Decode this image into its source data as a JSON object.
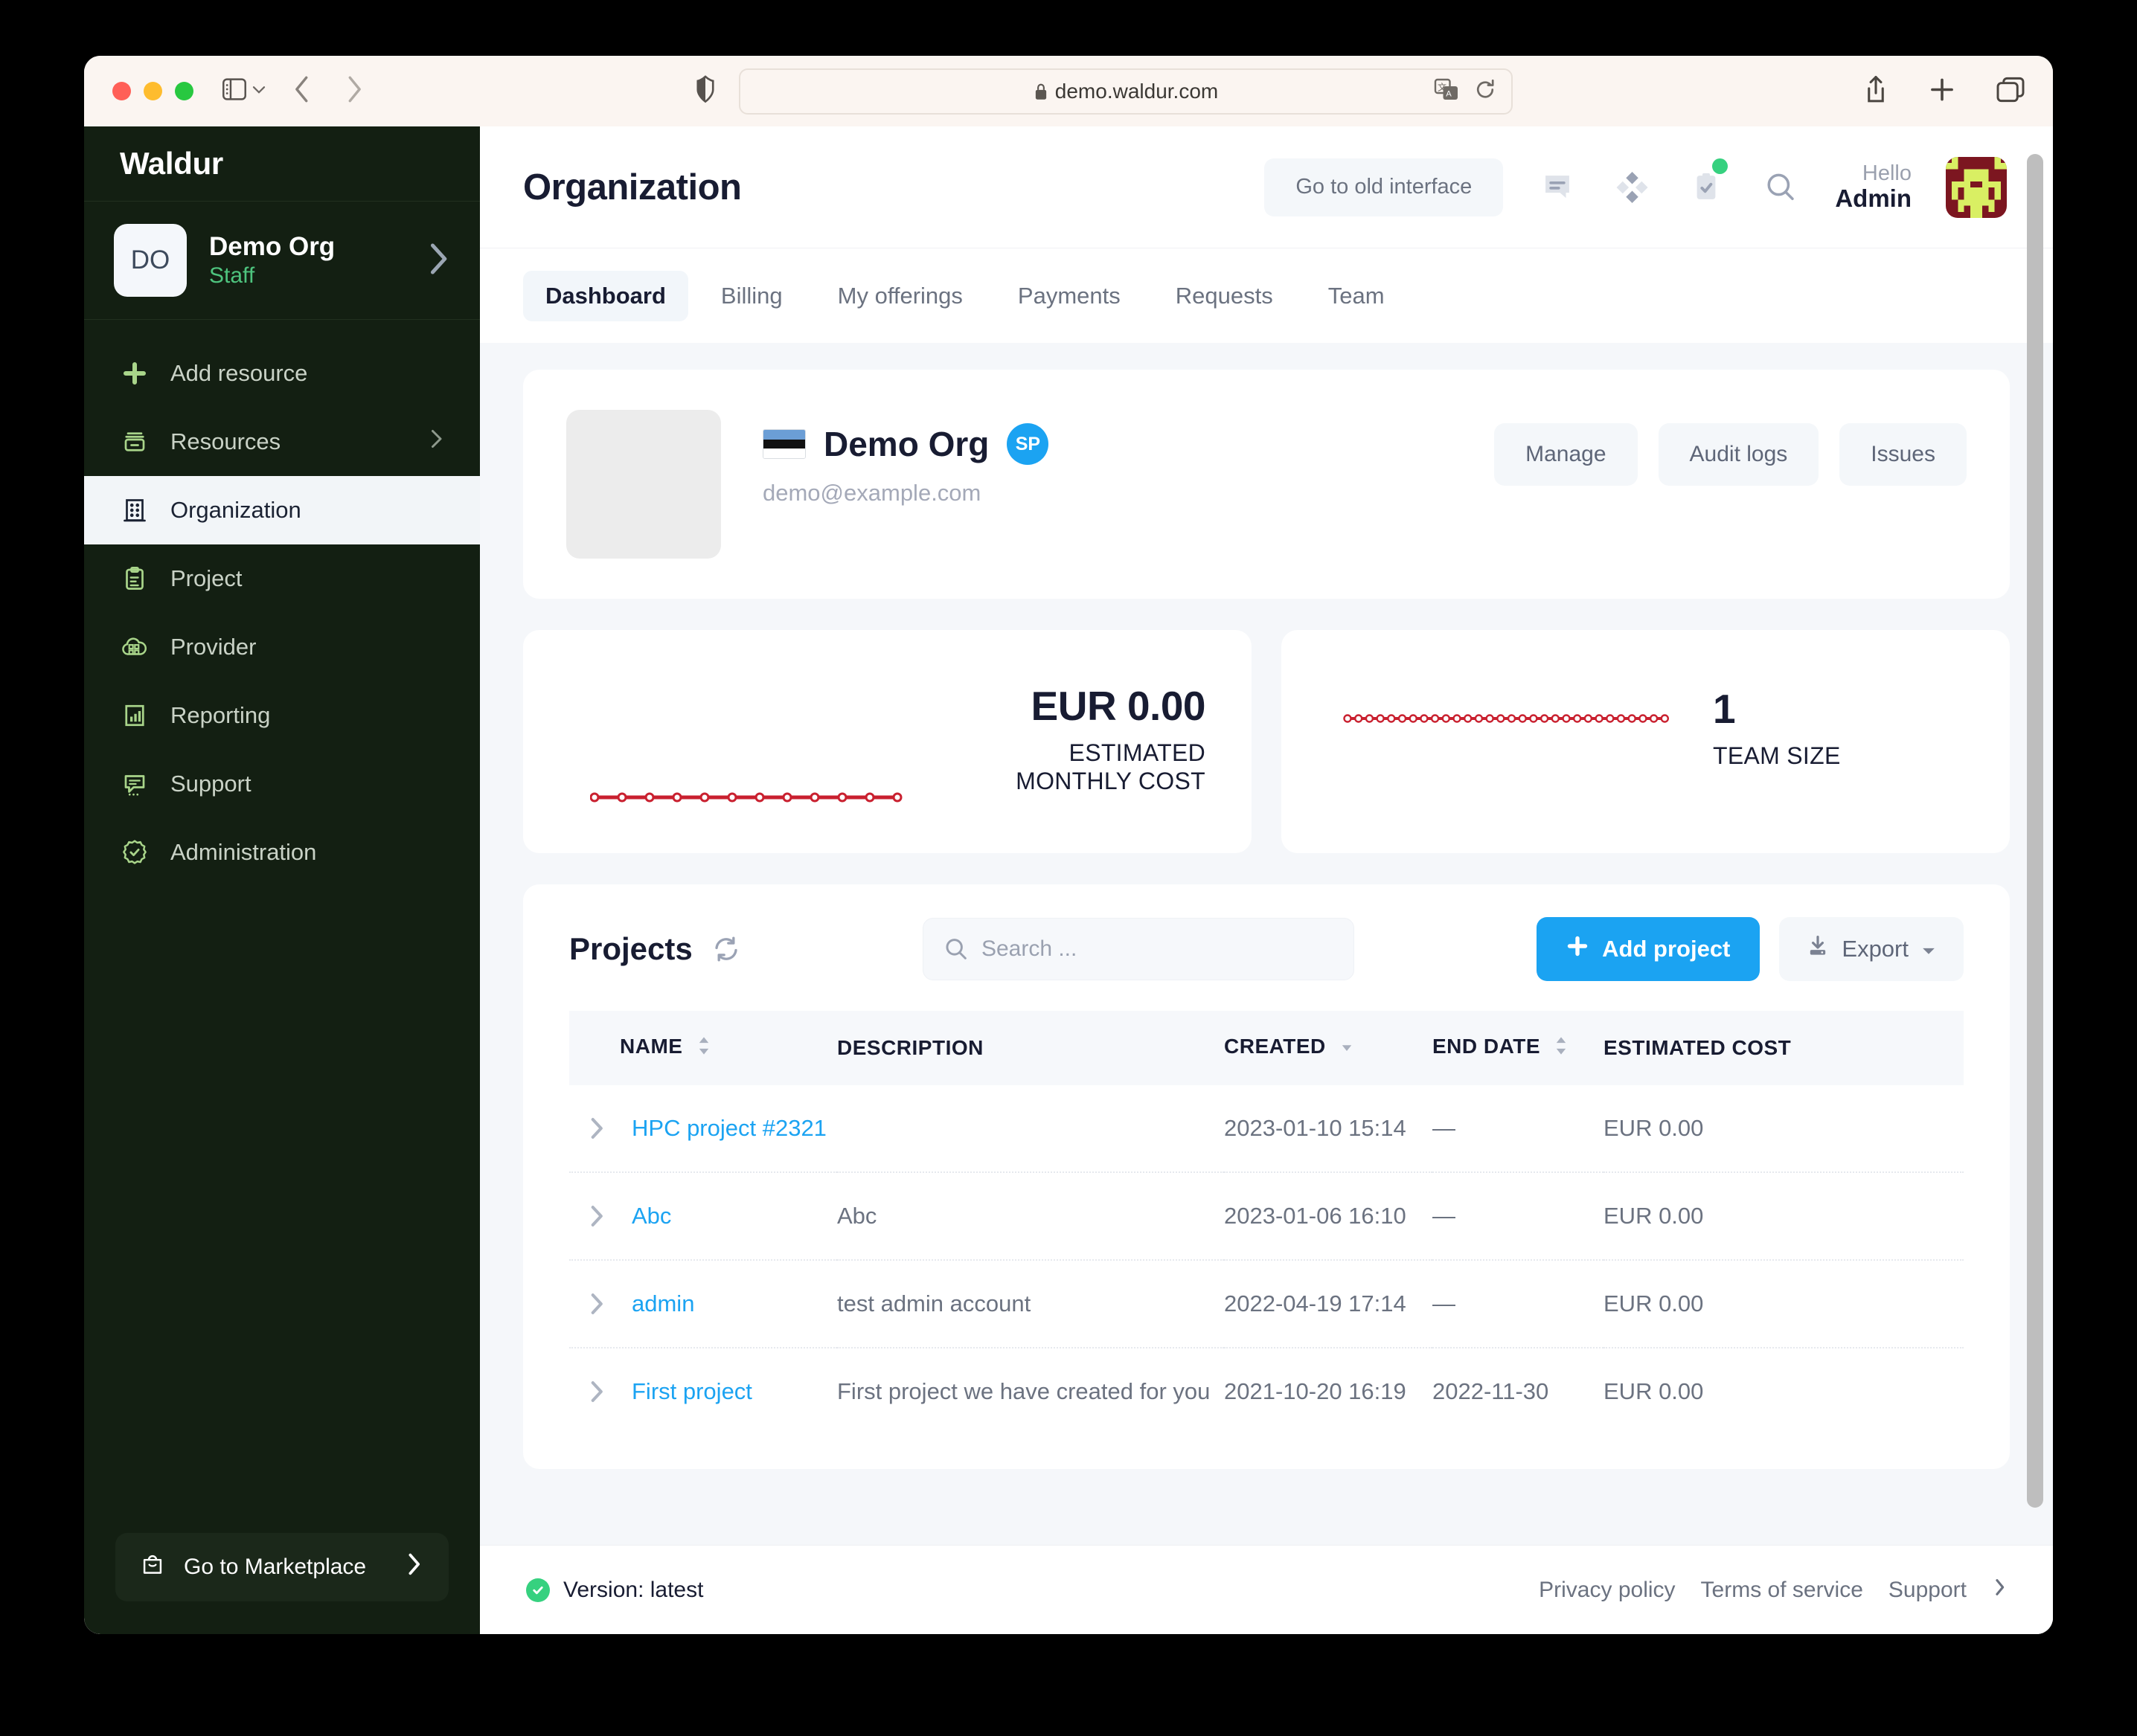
{
  "browser": {
    "url": "demo.waldur.com",
    "lock_icon": "lock-icon",
    "reload_icon": "reload-icon",
    "translate_icon": "translate-icon",
    "shield_icon": "shield-icon",
    "sidebar_toggle_icon": "sidebar-toggle-icon",
    "back_icon": "back-arrow-icon",
    "forward_icon": "forward-arrow-icon",
    "share_icon": "share-icon",
    "newtab_icon": "new-tab-icon",
    "tabs_icon": "tab-overview-icon"
  },
  "sidebar": {
    "brand": "Waldur",
    "org": {
      "initials": "DO",
      "name": "Demo Org",
      "role": "Staff"
    },
    "items": [
      {
        "label": "Add resource",
        "icon": "plus-icon",
        "active": false,
        "tail": ""
      },
      {
        "label": "Resources",
        "icon": "server-icon",
        "active": false,
        "tail": "chevron-right-icon"
      },
      {
        "label": "Organization",
        "icon": "building-icon",
        "active": true,
        "tail": ""
      },
      {
        "label": "Project",
        "icon": "clipboard-icon",
        "active": false,
        "tail": ""
      },
      {
        "label": "Provider",
        "icon": "cloud-icon",
        "active": false,
        "tail": ""
      },
      {
        "label": "Reporting",
        "icon": "chart-icon",
        "active": false,
        "tail": ""
      },
      {
        "label": "Support",
        "icon": "chat-icon",
        "active": false,
        "tail": ""
      },
      {
        "label": "Administration",
        "icon": "gear-check-icon",
        "active": false,
        "tail": ""
      }
    ],
    "marketplace": {
      "label": "Go to Marketplace",
      "icon": "bag-icon"
    }
  },
  "header": {
    "title": "Organization",
    "old_interface_label": "Go to old interface",
    "icons": [
      "chat-bubble-icon",
      "apps-diamond-icon",
      "clipboard-check-icon",
      "search-icon"
    ],
    "notification_dot_color": "#36d17f",
    "hello_label": "Hello",
    "user_name": "Admin"
  },
  "tabs": [
    {
      "label": "Dashboard",
      "active": true
    },
    {
      "label": "Billing",
      "active": false
    },
    {
      "label": "My offerings",
      "active": false
    },
    {
      "label": "Payments",
      "active": false
    },
    {
      "label": "Requests",
      "active": false
    },
    {
      "label": "Team",
      "active": false
    }
  ],
  "org_card": {
    "flag": "estonia-flag",
    "name": "Demo Org",
    "badge": "SP",
    "badge_color": "#1ba3f2",
    "email": "demo@example.com",
    "buttons": [
      "Manage",
      "Audit logs",
      "Issues"
    ]
  },
  "stats": [
    {
      "value": "EUR 0.00",
      "label": "ESTIMATED MONTHLY COST"
    },
    {
      "value": "1",
      "label": "TEAM SIZE"
    }
  ],
  "chart_data": [
    {
      "type": "line",
      "title": "Estimated monthly cost sparkline",
      "x": [
        1,
        2,
        3,
        4,
        5,
        6,
        7,
        8,
        9,
        10,
        11,
        12
      ],
      "values": [
        0,
        0,
        0,
        0,
        0,
        0,
        0,
        0,
        0,
        0,
        0,
        0
      ],
      "ylim": [
        0,
        1
      ],
      "color": "#c9202f",
      "markers": true,
      "grid": false,
      "legend": "none"
    },
    {
      "type": "line",
      "title": "Team size sparkline",
      "x": [
        1,
        2,
        3,
        4,
        5,
        6,
        7,
        8,
        9,
        10,
        11,
        12,
        13,
        14,
        15,
        16,
        17,
        18,
        19,
        20,
        21,
        22,
        23,
        24,
        25,
        26,
        27,
        28,
        29,
        30
      ],
      "values": [
        1,
        1,
        1,
        1,
        1,
        1,
        1,
        1,
        1,
        1,
        1,
        1,
        1,
        1,
        1,
        1,
        1,
        1,
        1,
        1,
        1,
        1,
        1,
        1,
        1,
        1,
        1,
        1,
        1,
        1
      ],
      "ylim": [
        0,
        2
      ],
      "color": "#c9202f",
      "markers": true,
      "grid": false,
      "legend": "none"
    }
  ],
  "projects": {
    "title": "Projects",
    "refresh_icon": "refresh-icon",
    "search_placeholder": "Search ...",
    "search_value": "",
    "add_button": "Add project",
    "export_button": "Export",
    "columns": [
      {
        "label": "NAME",
        "sort": "both"
      },
      {
        "label": "DESCRIPTION",
        "sort": "none"
      },
      {
        "label": "CREATED",
        "sort": "desc"
      },
      {
        "label": "END DATE",
        "sort": "both"
      },
      {
        "label": "ESTIMATED COST",
        "sort": "none"
      }
    ],
    "rows": [
      {
        "name": "HPC project #2321",
        "description": "",
        "created": "2023-01-10 15:14",
        "end_date": "—",
        "cost": "EUR 0.00"
      },
      {
        "name": "Abc",
        "description": "Abc",
        "created": "2023-01-06 16:10",
        "end_date": "—",
        "cost": "EUR 0.00"
      },
      {
        "name": "admin",
        "description": "test admin account",
        "created": "2022-04-19 17:14",
        "end_date": "—",
        "cost": "EUR 0.00"
      },
      {
        "name": "First project",
        "description": "First project we have created for you",
        "created": "2021-10-20 16:19",
        "end_date": "2022-11-30",
        "cost": "EUR 0.00"
      }
    ]
  },
  "footer": {
    "version": "Version: latest",
    "links": [
      "Privacy policy",
      "Terms of service",
      "Support"
    ]
  }
}
